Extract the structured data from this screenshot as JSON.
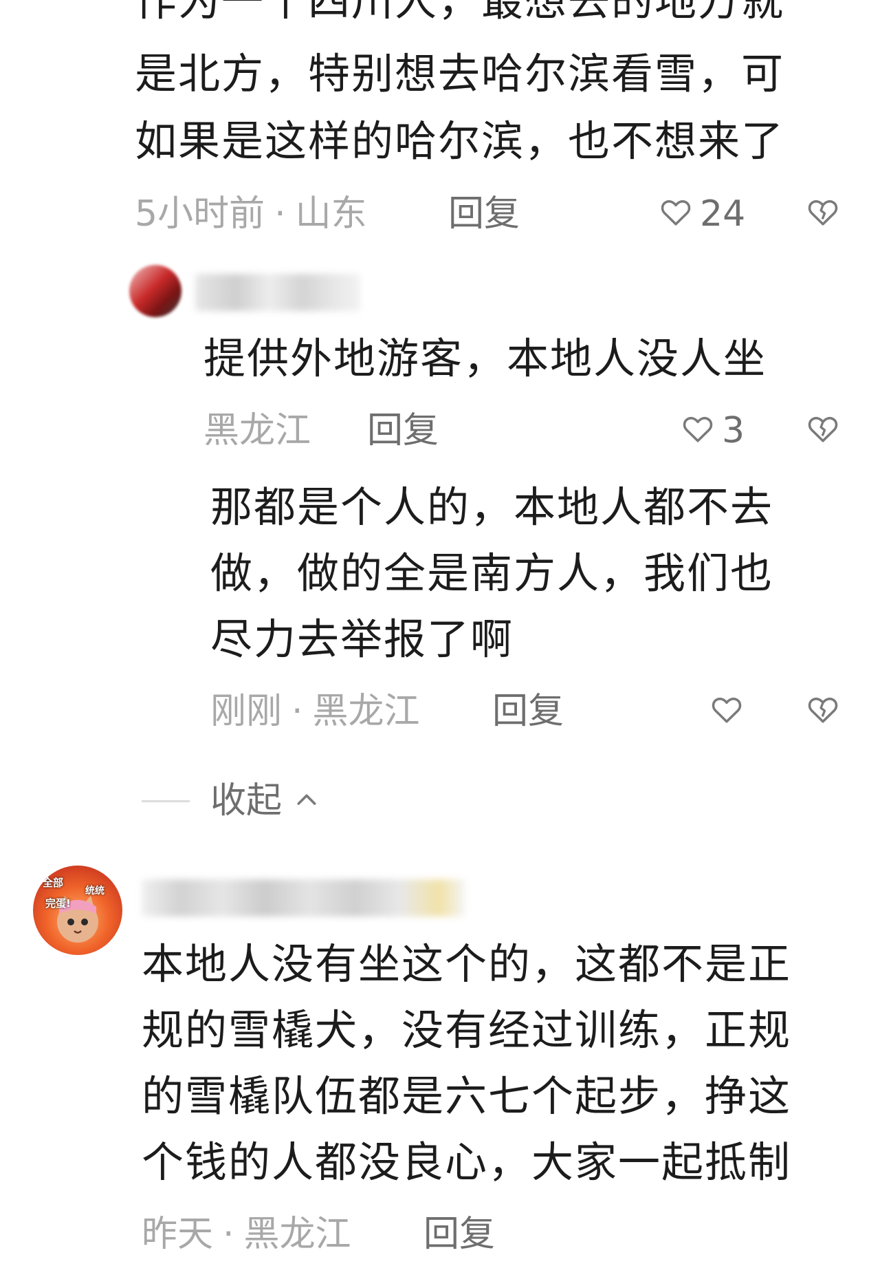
{
  "comment1": {
    "lines": [
      "作为一个四川人，最想去的地方就",
      "是北方，特别想去哈尔滨看雪，可",
      "如果是这样的哈尔滨，也不想来了"
    ],
    "time": "5小时前",
    "dot": "·",
    "location": "山东",
    "reply_label": "回复",
    "likes": "24",
    "icons": {
      "like": "heart-outline-icon",
      "dislike": "broken-heart-icon"
    }
  },
  "reply1": {
    "lines": [
      "提供外地游客，本地人没人坐"
    ],
    "location": "黑龙江",
    "reply_label": "回复",
    "likes": "3"
  },
  "reply2": {
    "lines": [
      "那都是个人的，本地人都不去",
      "做，做的全是南方人，我们也",
      "尽力去举报了啊"
    ],
    "time": "刚刚",
    "dot": "·",
    "location": "黑龙江",
    "reply_label": "回复"
  },
  "collapse": {
    "label": "收起",
    "icon": "chevron-up-icon"
  },
  "comment2": {
    "avatar_sticker_text": [
      "全部",
      "统统",
      "完蛋!"
    ],
    "lines": [
      "本地人没有坐这个的，这都不是正",
      "规的雪橇犬，没有经过训练，正规",
      "的雪橇队伍都是六七个起步，挣这",
      "个钱的人都没良心，大家一起抵制"
    ],
    "time": "昨天",
    "dot": "·",
    "location": "黑龙江",
    "reply_label": "回复"
  },
  "colors": {
    "text": "#1c1c1c",
    "meta": "#a8a8a8",
    "reply": "#6e6e6e",
    "icon": "#7a7a7a",
    "background": "#ffffff"
  }
}
